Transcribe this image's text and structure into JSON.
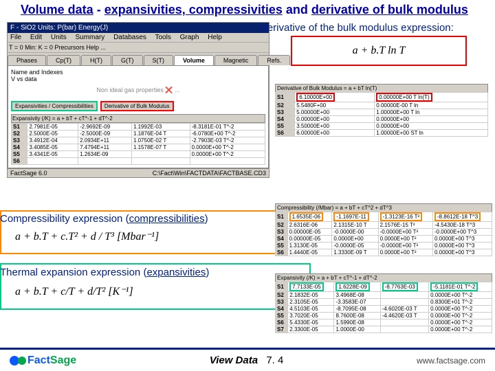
{
  "title_parts": {
    "a": "Volume data",
    "b": " - ",
    "c": "expansivities, compressivities",
    "d": " and ",
    "e": "derivative of bulk modulus"
  },
  "deriv_title": "Derivative of the bulk modulus expression:",
  "formula_deriv": "a + b.T ln T",
  "comp_title": "Compressibility expression (compressibilities)",
  "formula_comp": "a + b.T + c.T² +  d / T³     [Mbar⁻¹]",
  "therm_title": "Thermal expansion expression (expansivities)",
  "formula_therm": "a + b.T +  c/T  +  d/T²     [K⁻¹]",
  "window": {
    "title": "F - SiO2    Units: P(bar) Energy(J)",
    "menus": [
      "File",
      "Edit",
      "Units",
      "Summary",
      "Databases",
      "Tools",
      "Graph",
      "Help"
    ],
    "toolbar": "T = 0      Min: K = 0 Precursors    Help ...",
    "tabs": [
      "Phases",
      "Cp(T)",
      "H(T)",
      "G(T)",
      "S(T)",
      "Volume",
      "Magnetic",
      "Refs."
    ],
    "tab_active": "Volume",
    "pane_label": "Name and Indexes",
    "pane_val": "V vs data",
    "subbox": "Non ideal gas properties\n❌ ...",
    "btns": [
      "Expansivities / Compressibilities",
      "Derivative of Bulk Modulus"
    ],
    "grid_title": "Expansivity (/K) = a + bT + cT^-1 + dT^-2",
    "rows": [
      "S1",
      "S2",
      "S3",
      "S4",
      "S5",
      "S6"
    ],
    "cols": [
      "",
      "",
      "",
      ""
    ],
    "data": [
      [
        "2.7981E-05",
        "-2.9692E-09",
        "1.1992E-03",
        "-8.3181E-01 T^-2"
      ],
      [
        "2.5000E-05",
        "-2.5000E-09",
        "1.1876E-04 T",
        "-6.0780E+00 T^-2"
      ],
      [
        "3.4912E-04",
        "2.0934E+11",
        "1.0750E-02 T",
        "-2.7903E-03 T^-2"
      ],
      [
        "3.4085E-05",
        "7.4794E+11",
        "1.1578E-07 T",
        "0.0000E+00 T^-2"
      ],
      [
        "3.4341E-05",
        "1.2634E-09",
        "",
        "0.0000E+00 T^-2"
      ],
      [
        "",
        "",
        "",
        ""
      ]
    ],
    "status_l": "FactSage 6.0",
    "status_r": "C:\\Fact\\Win\\FACTDATA\\FACTBASE.CD3"
  },
  "deriv_panel": {
    "title": "Derivative of Bulk Modulus = a + bT ln(T)",
    "rows": [
      "S1",
      "S2",
      "S3",
      "S4",
      "S5",
      "S6"
    ],
    "data": [
      [
        "6.10000E+00",
        "0.00000E+00 T ln(T)"
      ],
      [
        "5.5480F+00",
        "0.00000E-00 T ln "
      ],
      [
        "5.00000E+00",
        "1.00000E+00 T ln "
      ],
      [
        "0.00000E+00",
        "0.00000E+00"
      ],
      [
        "3.50000E+00",
        "0.00000E+00"
      ],
      [
        "6.00000E+00",
        "1.00000E+00 ST ln "
      ]
    ]
  },
  "comp_panel": {
    "title": "Compressibility (/Mbar) = a + bT + cT^2 + dT^3",
    "rows": [
      "S1",
      "S2",
      "S3",
      "S4",
      "S5",
      "S6"
    ],
    "data": [
      [
        "1.6535E-06",
        "-1.1697E-11",
        "-1.3123E-16 T²",
        "-8.8612E-18 T^3"
      ],
      [
        "2.6316E-06",
        "2.1315E-10 T",
        "2.1576E-15 T²",
        "-4.5430E-18 T^3"
      ],
      [
        "0.00000E-05",
        "-0.0000E-00",
        "-0.0000E+00 T²",
        "-0.0000E+00 T^3"
      ],
      [
        "0.00000E-05",
        "0.0000E+00",
        "0.0000E+00 T²",
        "0.0000E+00 T^3"
      ],
      [
        "1.3130E-05",
        "-0.0000E-05",
        "-0.0000E+00 T²",
        "0.0000E+00 T^3"
      ],
      [
        "1.4440E-05",
        "1.3330E-09 T",
        "0.0000E+00 T²",
        "0.0000E+00 T^3"
      ]
    ]
  },
  "exp_panel": {
    "title": "Expansivity (/K) = a + bT + cT^-1 + dT^-2",
    "rows": [
      "S1",
      "S2",
      "S3",
      "S4",
      "S5",
      "S6"
    ],
    "data": [
      [
        "7.7133E-05",
        "1.6228E-09",
        "-8.7763E-03",
        "-5.1181E-01 T^-2"
      ],
      [
        "2.1832E-05",
        "3.4968E-08",
        "",
        "0.0000E+00 T^-2"
      ],
      [
        "2.3105E-05",
        "-3.3583E-07",
        "",
        "0.8300E+01 T^-2"
      ],
      [
        "4.5103E-05",
        "-8.7095E-08",
        "-4.6020E-03 T",
        "0.0000E+00 T^-2"
      ],
      [
        "3.7020E-05",
        "8.7600E-08",
        "-4.4620E-03 T",
        "0.0000E+00 T^-2"
      ],
      [
        "5.4330E-05",
        "1.5990E-08",
        "",
        "0.0000E+00 T^-2"
      ],
      [
        "2.3300E-05",
        "1.0000E-00",
        "",
        "0.0000E+00 T^-2"
      ]
    ]
  },
  "footer": {
    "view": "View Data",
    "ver": "7. 4",
    "url": "www.factsage.com"
  }
}
